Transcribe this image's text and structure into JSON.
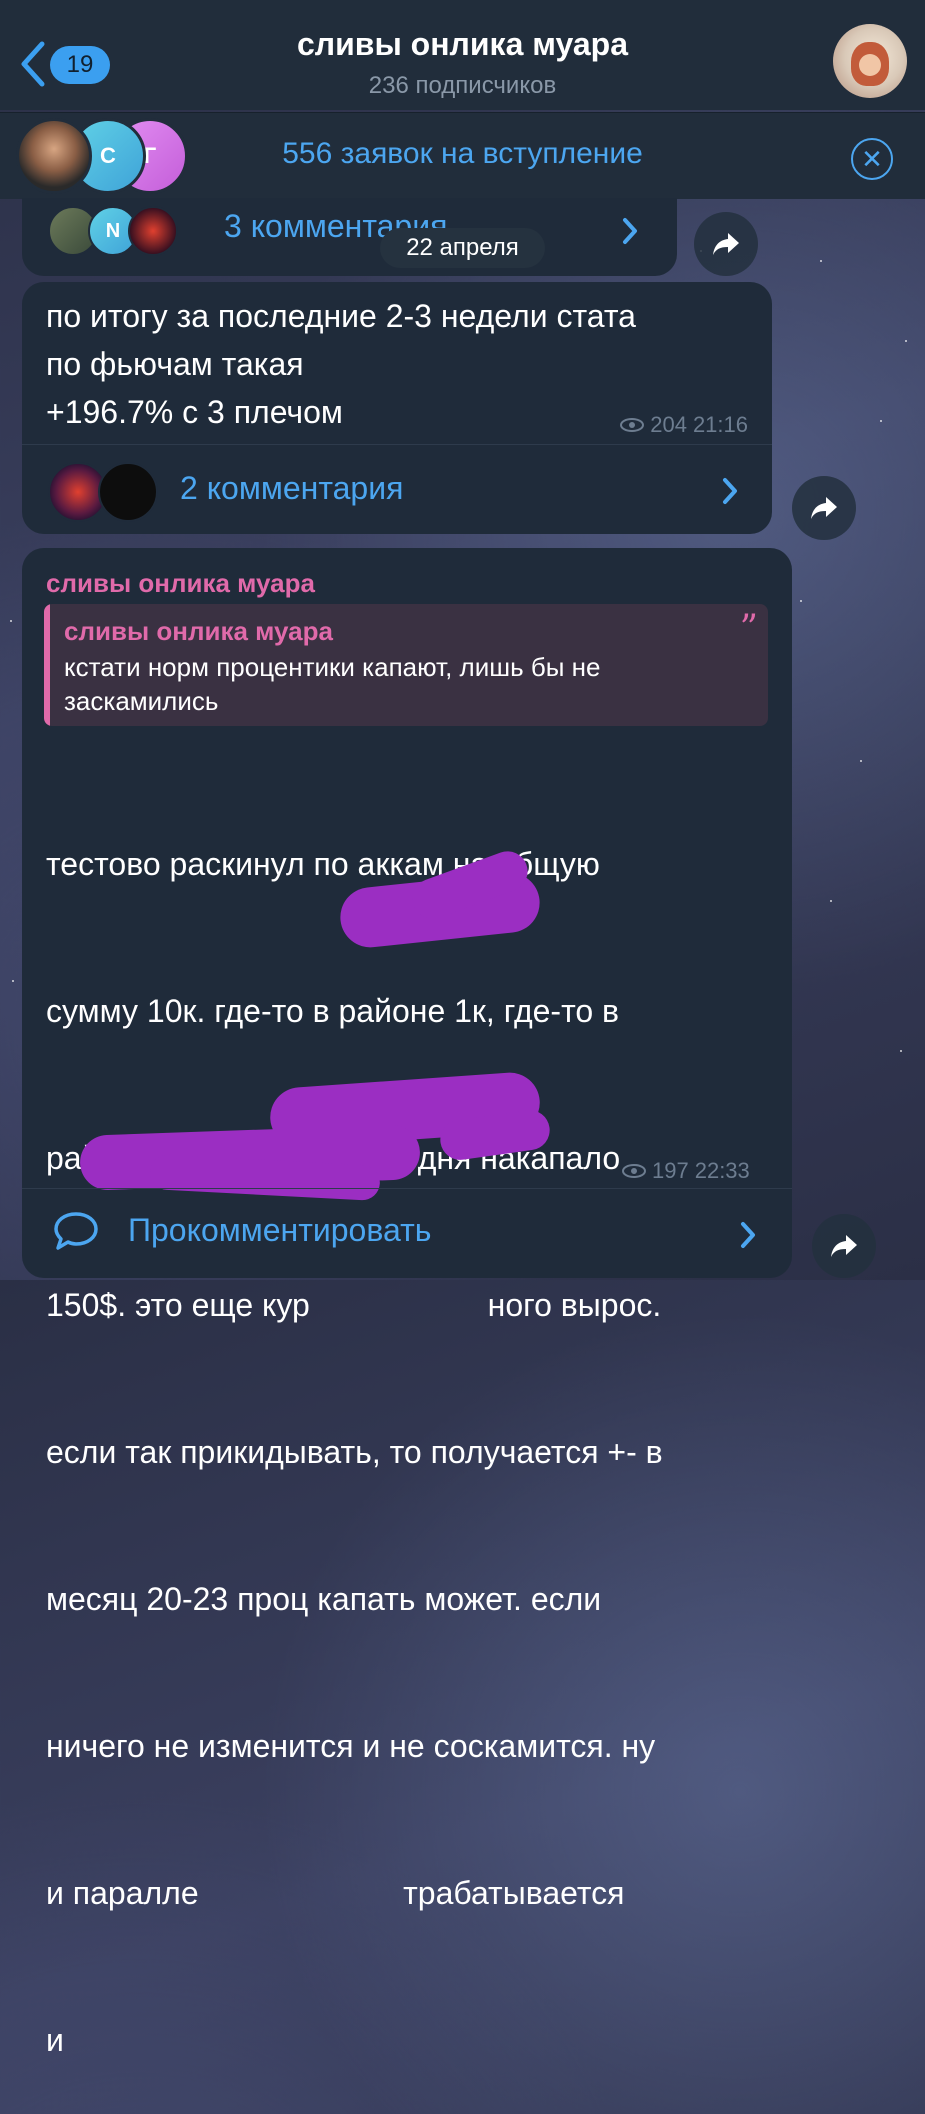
{
  "header": {
    "back_count": "19",
    "channel_title": "сливы онлика муара",
    "subscribers": "236 подписчиков"
  },
  "join_requests": {
    "avatar_letters": [
      "С",
      "Г"
    ],
    "label": "556 заявок на вступление"
  },
  "date_pill": "22 апреля",
  "posts": [
    {
      "comment_avatar_letter": "N",
      "comments_label": "3 комментария"
    },
    {
      "text": "по итогу за последние 2-3 недели стата\nпо фьючам такая\n+196.7% с 3 плечом",
      "views": "204",
      "time": "21:16",
      "comments_label": "2 комментария"
    },
    {
      "author": "сливы онлика муара",
      "quote_author": "сливы онлика муара",
      "quote_text": "кстати норм процентики капают, лишь бы не заскамились",
      "text_lines": [
        "тестово раскинул по аккам на общую",
        "сумму 10к. где-то в районе 1к, где-то в",
        "районе 500$ на акк. за 2 дня накапало",
        "150$. это еще кур                    ного вырос.",
        "если так прикидывать, то получается +- в",
        "месяц 20-23 проц капать может. если",
        "ничего не изменится и не соскамится. ну",
        "и паралле                       трабатывается",
        "и"
      ],
      "views": "197",
      "time": "22:33",
      "comment_action": "Прокомментировать"
    }
  ],
  "colors": {
    "accent": "#4ca6f0",
    "author": "#e06aaa",
    "redaction": "#9b2ec2",
    "bubble": "#1f2b3a"
  },
  "icons": [
    "back-chevron-icon",
    "close-icon",
    "eye-icon",
    "chevron-right-icon",
    "share-icon",
    "comment-icon"
  ]
}
